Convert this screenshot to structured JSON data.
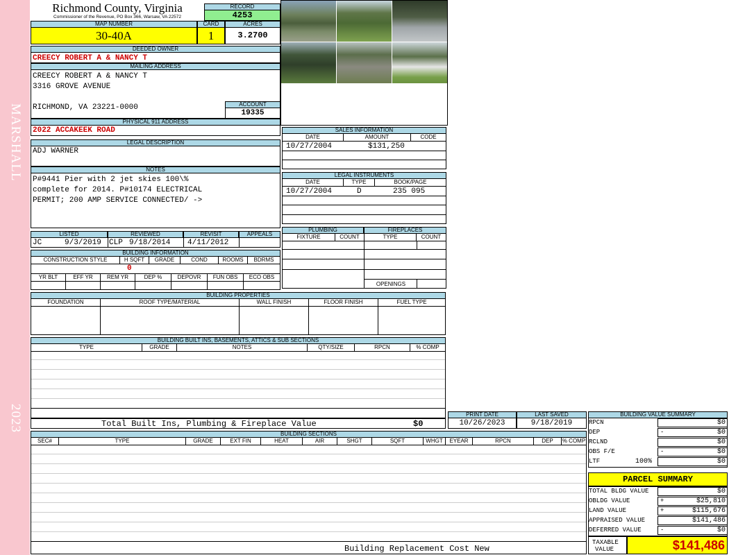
{
  "sidebar": {
    "top_text": "MARSHALL",
    "bottom_text": "2023"
  },
  "header": {
    "county": "Richmond County, Virginia",
    "commissioner": "Commissioner of the Revenue, PO Box 366, Warsaw, VA 22572",
    "record_label": "RECORD",
    "record_value": "4253",
    "map_label": "MAP NUMBER",
    "map_value": "30-40A",
    "card_label": "CARD",
    "card_value": "1",
    "acres_label": "ACRES",
    "acres_value": "3.2700"
  },
  "owner": {
    "deeded_label": "DEEDED OWNER",
    "deeded_value": "CREECY ROBERT A & NANCY T",
    "mailing_label": "MAILING ADDRESS",
    "mail_line1": "CREECY ROBERT A & NANCY T",
    "mail_line2": "3316 GROVE AVENUE",
    "mail_line3": "RICHMOND, VA 23221-0000",
    "account_label": "ACCOUNT",
    "account_value": "19335",
    "physical_label": "PHYSICAL 911 ADDRESS",
    "physical_value": "2022 ACCAKEEK ROAD"
  },
  "legal": {
    "label": "LEGAL DESCRIPTION",
    "value": "ADJ WARNER"
  },
  "notes": {
    "label": "NOTES",
    "line1": "P#9441 Pier with 2 jet skies 100\\%",
    "line2": "complete for 2014.  P#10174 ELECTRICAL",
    "line3": "PERMIT; 200 AMP SERVICE CONNECTED/ ->"
  },
  "dates": {
    "listed_label": "LISTED",
    "reviewed_label": "REVIEWED",
    "revisit_label": "REVISIT",
    "appeals_label": "APPEALS",
    "listed_by": "JC",
    "listed_date": "9/3/2019",
    "reviewed_by": "CLP",
    "reviewed_date": "9/18/2014",
    "revisit_date": "4/11/2012"
  },
  "building_info": {
    "label": "BUILDING INFORMATION",
    "cols1": [
      "CONSTRUCTION STYLE",
      "H SQFT",
      "GRADE",
      "COND",
      "ROOMS",
      "BDRMS"
    ],
    "hsqft_value": "0",
    "cols2": [
      "YR BLT",
      "EFF YR",
      "REM YR",
      "DEP %",
      "DEPOVR",
      "FUN OBS",
      "ECO OBS"
    ]
  },
  "sales": {
    "label": "SALES INFORMATION",
    "cols": [
      "DATE",
      "AMOUNT",
      "CODE"
    ],
    "row_date": "10/27/2004",
    "row_amount": "$131,250"
  },
  "legal_instruments": {
    "label": "LEGAL INSTRUMENTS",
    "cols": [
      "DATE",
      "TYPE",
      "BOOK/PAGE"
    ],
    "row_date": "10/27/2004",
    "row_type": "D",
    "row_book": "235 095"
  },
  "plumbing": {
    "label": "PLUMBING",
    "cols": [
      "FIXTURE",
      "COUNT"
    ]
  },
  "fireplaces": {
    "label": "FIREPLACES",
    "cols": [
      "TYPE",
      "COUNT"
    ],
    "openings": "OPENINGS"
  },
  "properties": {
    "label": "BUILDING PROPERTIES",
    "cols": [
      "FOUNDATION",
      "ROOF TYPE/MATERIAL",
      "WALL FINISH",
      "FLOOR FINISH",
      "FUEL TYPE"
    ]
  },
  "builtins": {
    "label": "BUILDING BUILT INS, BASEMENTS, ATTICS & SUB SECTIONS",
    "cols": [
      "TYPE",
      "GRADE",
      "NOTES",
      "QTY/SIZE",
      "RPCN",
      "% COMP"
    ],
    "total_label": "Total Built Ins, Plumbing & Fireplace Value",
    "total_value": "$0"
  },
  "print": {
    "print_label": "PRINT DATE",
    "saved_label": "LAST SAVED",
    "print_value": "10/26/2023",
    "saved_value": "9/18/2019"
  },
  "sections": {
    "label": "BUILDING SECTIONS",
    "cols": [
      "SEC#",
      "TYPE",
      "GRADE",
      "EXT FIN",
      "HEAT",
      "AIR",
      "SHGT",
      "SQFT",
      "WHGT",
      "EYEAR",
      "RPCN",
      "DEP",
      "% COMP"
    ],
    "footer": "Building Replacement Cost New"
  },
  "bvs": {
    "label": "BUILDING VALUE SUMMARY",
    "rows": [
      {
        "k": "RPCN",
        "s": "",
        "v": "$0"
      },
      {
        "k": "DEP",
        "s": "-",
        "v": "$0"
      },
      {
        "k": "RCLND",
        "s": "",
        "v": "$0"
      },
      {
        "k": "OBS F/E",
        "s": "-",
        "v": "$0"
      },
      {
        "k": "LTF",
        "s": "",
        "v": "$0",
        "pct": "100%"
      }
    ]
  },
  "parcel": {
    "label": "PARCEL SUMMARY",
    "rows": [
      {
        "k": "TOTAL BLDG VALUE",
        "s": "",
        "v": "$0"
      },
      {
        "k": "OBLDG VALUE",
        "s": "+",
        "v": "$25,810"
      },
      {
        "k": "LAND VALUE",
        "s": "+",
        "v": "$115,676"
      },
      {
        "k": "APPRAISED VALUE",
        "s": "",
        "v": "$141,486"
      },
      {
        "k": "DEFERRED VALUE",
        "s": "-",
        "v": "$0"
      }
    ],
    "taxable_label1": "TAXABLE",
    "taxable_label2": "VALUE",
    "taxable_value": "$141,486"
  },
  "colors": {
    "header_blue": "#add8e6",
    "yellow": "#ffff00",
    "green": "#90ee90",
    "red_text": "#cc0000",
    "sidebar_pink": "#f9c7cf"
  },
  "photos": [
    "house-photo",
    "yard-photo",
    "pier-photo",
    "tree-photo",
    "shed-photo",
    "mobile-home-photo"
  ]
}
